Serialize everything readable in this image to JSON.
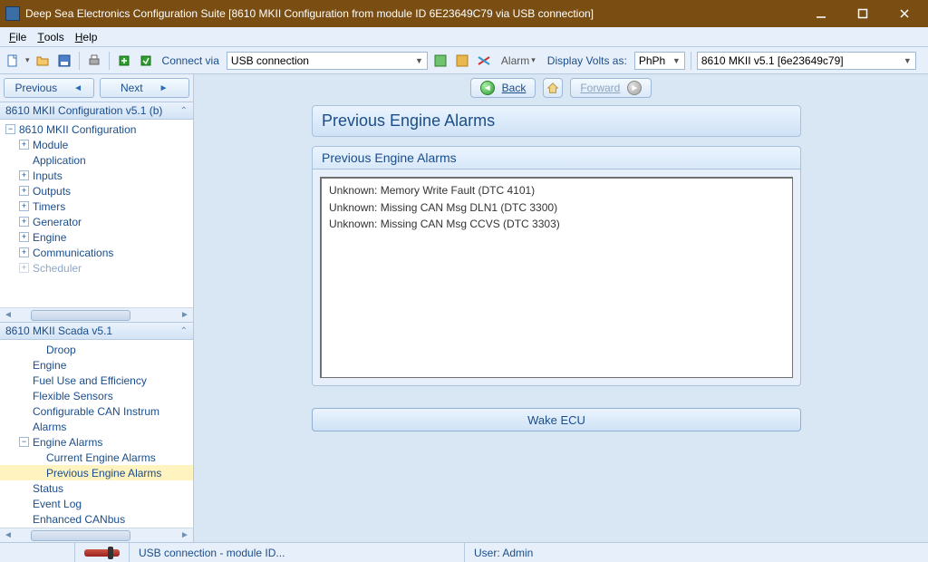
{
  "window": {
    "title": "Deep Sea Electronics Configuration Suite [8610 MKII Configuration from module ID 6E23649C79 via USB connection]"
  },
  "menu": {
    "file": "File",
    "tools": "Tools",
    "help": "Help"
  },
  "toolbar": {
    "connect_via": "Connect via",
    "connection": "USB connection",
    "alarm": "Alarm",
    "display_volts": "Display Volts as:",
    "volts_mode": "PhPh",
    "module_combo": "8610 MKII v5.1 [6e23649c79]"
  },
  "nav": {
    "previous": "Previous",
    "next": "Next"
  },
  "tree1": {
    "header": "8610 MKII Configuration v5.1 (b)",
    "root": "8610 MKII Configuration",
    "items": [
      "Module",
      "Application",
      "Inputs",
      "Outputs",
      "Timers",
      "Generator",
      "Engine",
      "Communications",
      "Scheduler"
    ]
  },
  "tree2": {
    "header": "8610 MKII Scada v5.1",
    "items": [
      "Droop",
      "Engine",
      "Fuel Use and Efficiency",
      "Flexible Sensors",
      "Configurable CAN Instrum",
      "Alarms",
      "Engine Alarms",
      "Current Engine Alarms",
      "Previous Engine Alarms",
      "Status",
      "Event Log",
      "Enhanced CANbus"
    ]
  },
  "mainnav": {
    "back": "Back",
    "forward": "Forward"
  },
  "page": {
    "title": "Previous Engine Alarms",
    "subtitle": "Previous Engine Alarms",
    "alarms": [
      "Unknown: Memory Write Fault (DTC 4101)",
      "Unknown: Missing CAN Msg DLN1 (DTC 3300)",
      "Unknown: Missing CAN Msg CCVS (DTC 3303)"
    ],
    "wake": "Wake ECU"
  },
  "status": {
    "connection": "USB connection - module ID...",
    "user": "User: Admin"
  }
}
